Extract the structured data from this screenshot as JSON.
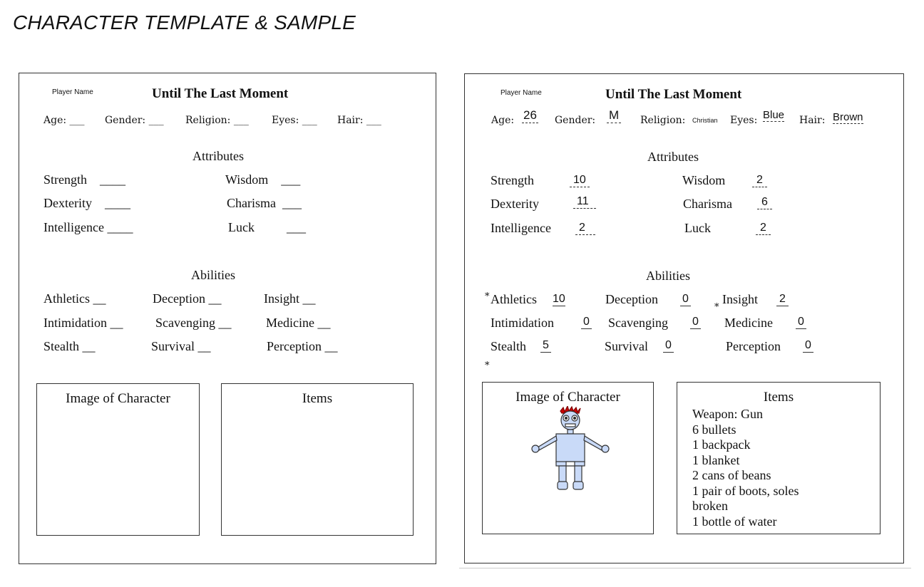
{
  "heading": "CHARACTER TEMPLATE & SAMPLE",
  "template": {
    "player_name_label": "Player Name",
    "title": "Until The Last Moment",
    "info": {
      "age": "Age: ___",
      "gender": "Gender: ___",
      "religion": "Religion: ___",
      "eyes": "Eyes: ___",
      "hair": "Hair: ___"
    },
    "attributes_heading": "Attributes",
    "attributes": {
      "strength": "Strength    ____",
      "wisdom": "Wisdom    ___",
      "dexterity": "Dexterity    ____",
      "charisma": "Charisma  ___",
      "intelligence": "Intelligence ____",
      "luck": "Luck          ___"
    },
    "abilities_heading": "Abilities",
    "abilities": {
      "athletics": "Athletics __",
      "deception": "Deception __",
      "insight": "Insight __",
      "intimidation": "Intimidation __",
      "scavenging": "Scavenging __",
      "medicine": "Medicine __",
      "stealth": "Stealth __",
      "survival": "Survival __",
      "perception": "Perception __"
    },
    "image_box_title": "Image of Character",
    "items_box_title": "Items"
  },
  "sample": {
    "player_name_label": "Player Name",
    "title": "Until The Last Moment",
    "info": {
      "age_label": "Age:",
      "age_value": "26",
      "gender_label": "Gender:",
      "gender_value": "M",
      "religion_label": "Religion:",
      "religion_value": "Christian",
      "eyes_label": "Eyes:",
      "eyes_value": "Blue",
      "hair_label": "Hair:",
      "hair_value": "Brown"
    },
    "attributes_heading": "Attributes",
    "attributes": [
      {
        "label": "Strength",
        "value": "10"
      },
      {
        "label": "Wisdom",
        "value": "2"
      },
      {
        "label": "Dexterity",
        "value": "11"
      },
      {
        "label": "Charisma",
        "value": "6"
      },
      {
        "label": "Intelligence",
        "value": "2"
      },
      {
        "label": "Luck",
        "value": "2"
      }
    ],
    "abilities_heading": "Abilities",
    "abilities": [
      {
        "label": "Athletics",
        "value": "10",
        "starred": true
      },
      {
        "label": "Deception",
        "value": "0",
        "starred": false
      },
      {
        "label": "Insight",
        "value": "2",
        "starred": true
      },
      {
        "label": "Intimidation",
        "value": "0",
        "starred": false
      },
      {
        "label": "Scavenging",
        "value": "0",
        "starred": false
      },
      {
        "label": "Medicine",
        "value": "0",
        "starred": false
      },
      {
        "label": "Stealth",
        "value": "5",
        "starred": true
      },
      {
        "label": "Survival",
        "value": "0",
        "starred": false
      },
      {
        "label": "Perception",
        "value": "0",
        "starred": false
      }
    ],
    "star_mark": "*",
    "image_box_title": "Image of Character",
    "items_box_title": "Items",
    "items": [
      "Weapon: Gun",
      "6 bullets",
      "1 backpack",
      "1 blanket",
      "2 cans of beans",
      "1 pair of boots, soles",
      "broken",
      "1 bottle of water"
    ],
    "colors": {
      "robot_body": "#c9daf8",
      "robot_hair": "#cc0000"
    }
  }
}
